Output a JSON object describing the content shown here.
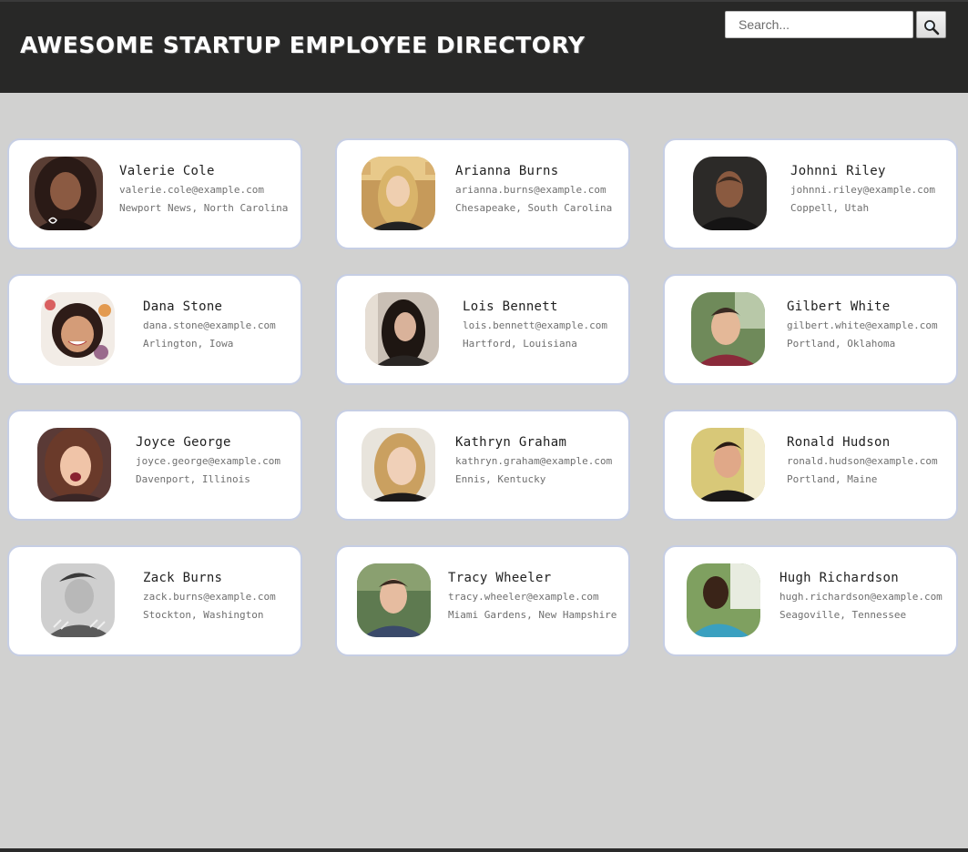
{
  "header": {
    "title": "Awesome Startup Employee Directory",
    "search_placeholder": "Search...",
    "search_value": ""
  },
  "colors": {
    "header_bg": "#282827",
    "page_bg": "#d1d1d0",
    "card_border": "#c6cee4"
  },
  "employees": [
    {
      "name": "Valerie Cole",
      "email": "valerie.cole@example.com",
      "location": "Newport News, North Carolina"
    },
    {
      "name": "Arianna Burns",
      "email": "arianna.burns@example.com",
      "location": "Chesapeake, South Carolina"
    },
    {
      "name": "Johnni Riley",
      "email": "johnni.riley@example.com",
      "location": "Coppell, Utah"
    },
    {
      "name": "Dana Stone",
      "email": "dana.stone@example.com",
      "location": "Arlington, Iowa"
    },
    {
      "name": "Lois Bennett",
      "email": "lois.bennett@example.com",
      "location": "Hartford, Louisiana"
    },
    {
      "name": "Gilbert White",
      "email": "gilbert.white@example.com",
      "location": "Portland, Oklahoma"
    },
    {
      "name": "Joyce George",
      "email": "joyce.george@example.com",
      "location": "Davenport, Illinois"
    },
    {
      "name": "Kathryn Graham",
      "email": "kathryn.graham@example.com",
      "location": "Ennis, Kentucky"
    },
    {
      "name": "Ronald Hudson",
      "email": "ronald.hudson@example.com",
      "location": "Portland, Maine"
    },
    {
      "name": "Zack Burns",
      "email": "zack.burns@example.com",
      "location": "Stockton, Washington"
    },
    {
      "name": "Tracy Wheeler",
      "email": "tracy.wheeler@example.com",
      "location": "Miami Gardens, New Hampshire"
    },
    {
      "name": "Hugh Richardson",
      "email": "hugh.richardson@example.com",
      "location": "Seagoville, Tennessee"
    }
  ]
}
